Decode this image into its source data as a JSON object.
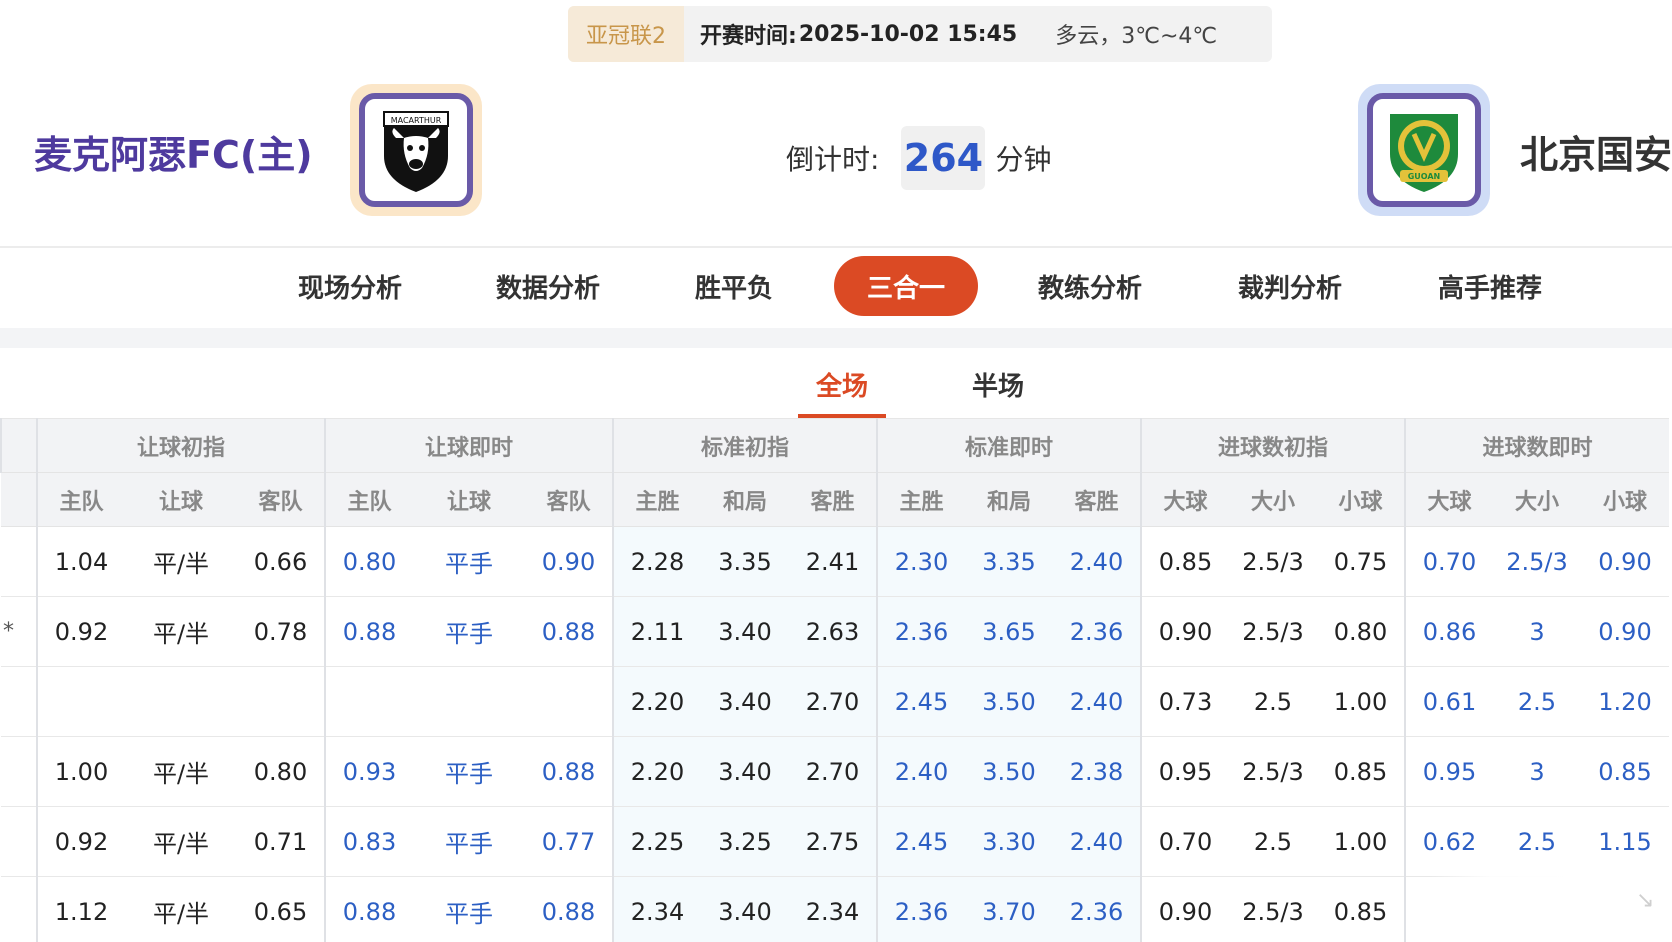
{
  "match": {
    "league": "亚冠联2",
    "kickoff_label": "开赛时间:",
    "kickoff_time": "2025-10-02 15:45",
    "weather": "多云，3℃~4℃"
  },
  "home_team": {
    "name": "麦克阿瑟FC(主)",
    "logo_text": "MACARTHUR"
  },
  "away_team": {
    "name": "北京国安",
    "logo_text": "GUOAN"
  },
  "countdown": {
    "label": "倒计时:",
    "value": "264",
    "unit": "分钟"
  },
  "nav": {
    "items": [
      "现场分析",
      "数据分析",
      "胜平负",
      "三合一",
      "教练分析",
      "裁判分析",
      "高手推荐"
    ],
    "active": "三合一"
  },
  "sub_tabs": {
    "items": [
      "全场",
      "半场"
    ],
    "active": "全场"
  },
  "table": {
    "groups": [
      "让球初指",
      "让球即时",
      "标准初指",
      "标准即时",
      "进球数初指",
      "进球数即时"
    ],
    "subheaders": [
      "主队",
      "让球",
      "客队",
      "主队",
      "让球",
      "客队",
      "主胜",
      "和局",
      "客胜",
      "主胜",
      "和局",
      "客胜",
      "大球",
      "大小",
      "小球",
      "大球",
      "大小",
      "小球"
    ],
    "rows": [
      {
        "mark": "",
        "cells": [
          "1.04",
          "平/半",
          "0.66",
          "0.80",
          "平手",
          "0.90",
          "2.28",
          "3.35",
          "2.41",
          "2.30",
          "3.35",
          "2.40",
          "0.85",
          "2.5/3",
          "0.75",
          "0.70",
          "2.5/3",
          "0.90"
        ]
      },
      {
        "mark": "*",
        "cells": [
          "0.92",
          "平/半",
          "0.78",
          "0.88",
          "平手",
          "0.88",
          "2.11",
          "3.40",
          "2.63",
          "2.36",
          "3.65",
          "2.36",
          "0.90",
          "2.5/3",
          "0.80",
          "0.86",
          "3",
          "0.90"
        ]
      },
      {
        "mark": "",
        "cells": [
          "",
          "",
          "",
          "",
          "",
          "",
          "2.20",
          "3.40",
          "2.70",
          "2.45",
          "3.50",
          "2.40",
          "0.73",
          "2.5",
          "1.00",
          "0.61",
          "2.5",
          "1.20"
        ]
      },
      {
        "mark": "",
        "cells": [
          "1.00",
          "平/半",
          "0.80",
          "0.93",
          "平手",
          "0.88",
          "2.20",
          "3.40",
          "2.70",
          "2.40",
          "3.50",
          "2.38",
          "0.95",
          "2.5/3",
          "0.85",
          "0.95",
          "3",
          "0.85"
        ]
      },
      {
        "mark": "",
        "cells": [
          "0.92",
          "平/半",
          "0.71",
          "0.83",
          "平手",
          "0.77",
          "2.25",
          "3.25",
          "2.75",
          "2.45",
          "3.30",
          "2.40",
          "0.70",
          "2.5",
          "1.00",
          "0.62",
          "2.5",
          "1.15"
        ]
      },
      {
        "mark": "",
        "cells": [
          "1.12",
          "平/半",
          "0.65",
          "0.88",
          "平手",
          "0.88",
          "2.34",
          "3.40",
          "2.34",
          "2.36",
          "3.70",
          "2.36",
          "0.90",
          "2.5/3",
          "0.85",
          "",
          "",
          ""
        ]
      }
    ]
  },
  "colors": {
    "accent": "#db4a24",
    "live_odds": "#2c5fc4",
    "home_name": "#4e3a9e",
    "league_tag": "#c8964a"
  }
}
